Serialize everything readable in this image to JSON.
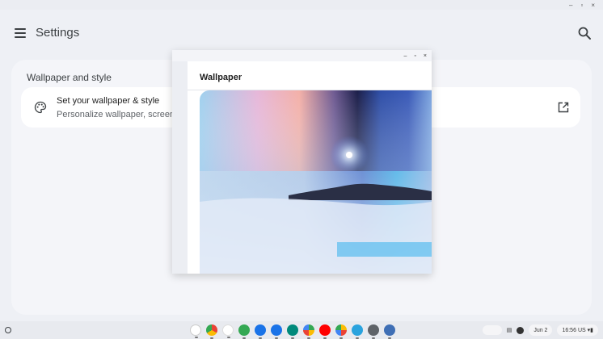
{
  "window_controls": [
    "–",
    "▫",
    "×"
  ],
  "header": {
    "title": "Settings",
    "menu_icon": "hamburger-icon",
    "search_icon": "search-icon"
  },
  "section": {
    "title": "Wallpaper and style",
    "row": {
      "title": "Set your wallpaper & style",
      "subtitle": "Personalize wallpaper, screen s",
      "icon": "palette-icon",
      "action_icon": "open-in-new-icon"
    }
  },
  "wallpaper_window": {
    "controls": [
      "–",
      "▫",
      "×"
    ],
    "title": "Wallpaper"
  },
  "shelf": {
    "apps": [
      {
        "name": "assistant",
        "color": "#ffffff"
      },
      {
        "name": "chrome",
        "color": "#e94235"
      },
      {
        "name": "gmail",
        "color": "#ffffff"
      },
      {
        "name": "tasks",
        "color": "#34a853"
      },
      {
        "name": "files",
        "color": "#1a73e8"
      },
      {
        "name": "messages",
        "color": "#1a73e8"
      },
      {
        "name": "meet",
        "color": "#00897b"
      },
      {
        "name": "play-store",
        "color": "#34a853"
      },
      {
        "name": "youtube",
        "color": "#ff0000"
      },
      {
        "name": "photos",
        "color": "#fbbc04"
      },
      {
        "name": "telegram",
        "color": "#2aa3de"
      },
      {
        "name": "settings",
        "color": "#5f6368"
      },
      {
        "name": "wallpaper",
        "color": "#3f6fb5"
      }
    ],
    "date": "Jun 2",
    "time": "16:56",
    "locale": "US"
  },
  "colors": {
    "accent": "#1a73e8",
    "background": "#eef0f5"
  }
}
